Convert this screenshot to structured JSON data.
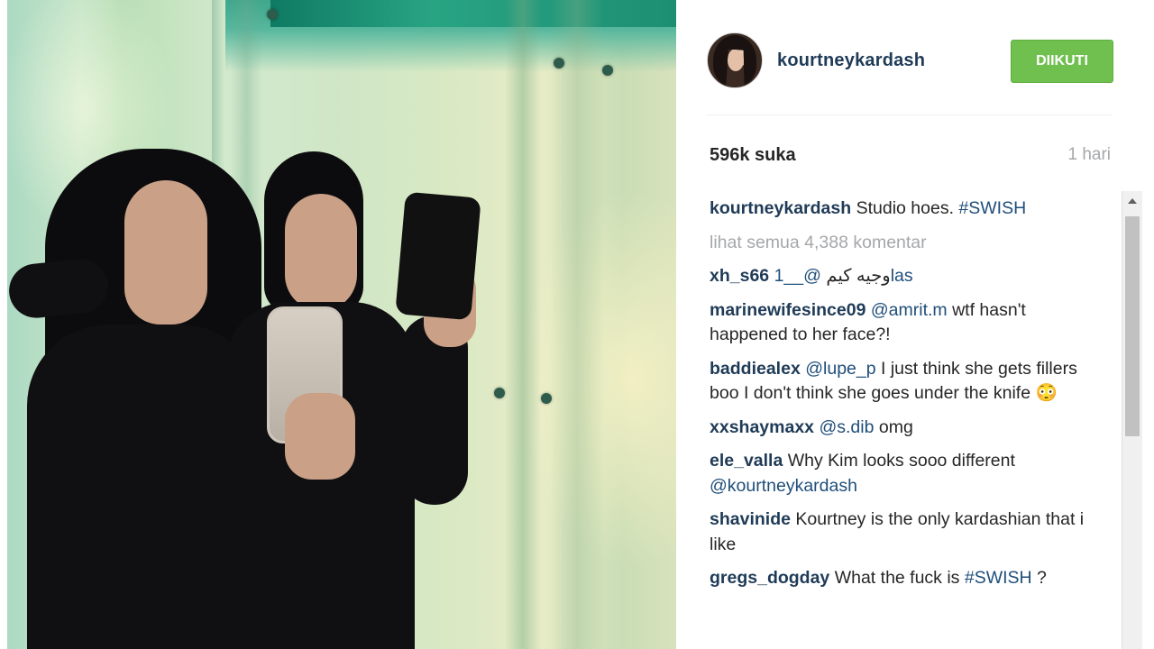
{
  "post": {
    "image_alt": "Two women in black outfits taking a mirror selfie in a green-lit studio",
    "username": "kourtneykardash",
    "follow_label": "DIIKUTI",
    "likes": "596k suka",
    "time": "1 hari"
  },
  "caption": {
    "user": "kourtneykardash",
    "text": " Studio hoes. ",
    "hashtag": "#SWISH"
  },
  "view_all": "lihat semua 4,388 komentar",
  "comments": [
    {
      "user": "xh_s66",
      "text": " وجيه كيم⁣ ",
      "mention": "@__1las"
    },
    {
      "user": "marinewifesince09",
      "mention": "@amrit.m",
      "text": " wtf hasn't happened to her face?!"
    },
    {
      "user": "baddiealex",
      "mention": "@lupe_p",
      "text": " I just think she gets fillers boo I don't think she goes under the knife 😳"
    },
    {
      "user": "xxshaymaxx",
      "mention": "@s.dib",
      "text": " omg"
    },
    {
      "user": "ele_valla",
      "text": " Why Kim looks sooo different ",
      "mention": "@kourtneykardash"
    },
    {
      "user": "shavinide",
      "text": " Kourtney is the only kardashian that i like"
    },
    {
      "user": "gregs_dogday",
      "text": " What the fuck is ",
      "hashtag": "#SWISH",
      "tail": " ?"
    }
  ],
  "colors": {
    "follow_button": "#70c050",
    "username": "#1f3b57",
    "muted": "#a5a7aa"
  }
}
